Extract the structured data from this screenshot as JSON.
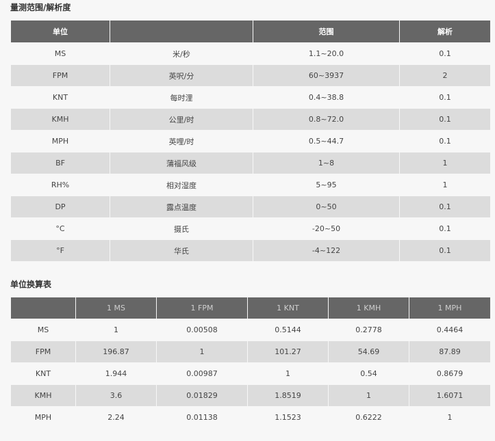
{
  "range_section": {
    "title": "量测范围/解析度",
    "headers": [
      "单位",
      "",
      "范围",
      "解析"
    ],
    "rows": [
      [
        "MS",
        "米/秒",
        "1.1~20.0",
        "0.1"
      ],
      [
        "FPM",
        "英呎/分",
        "60~3937",
        "2"
      ],
      [
        "KNT",
        "每时浬",
        "0.4~38.8",
        "0.1"
      ],
      [
        "KMH",
        "公里/时",
        "0.8~72.0",
        "0.1"
      ],
      [
        "MPH",
        "英哩/时",
        "0.5~44.7",
        "0.1"
      ],
      [
        "BF",
        "蒲福风级",
        "1~8",
        "1"
      ],
      [
        "RH%",
        "相对湿度",
        "5~95",
        "1"
      ],
      [
        "DP",
        "露点温度",
        "0~50",
        "0.1"
      ],
      [
        "°C",
        "摄氏",
        "-20~50",
        "0.1"
      ],
      [
        "°F",
        "华氏",
        "-4~122",
        "0.1"
      ]
    ]
  },
  "conversion_section": {
    "title": "单位换算表",
    "headers": [
      "",
      "1 MS",
      "1 FPM",
      "1 KNT",
      "1 KMH",
      "1 MPH"
    ],
    "rows": [
      [
        "MS",
        "1",
        "0.00508",
        "0.5144",
        "0.2778",
        "0.4464"
      ],
      [
        "FPM",
        "196.87",
        "1",
        "101.27",
        "54.69",
        "87.89"
      ],
      [
        "KNT",
        "1.944",
        "0.00987",
        "1",
        "0.54",
        "0.8679"
      ],
      [
        "KMH",
        "3.6",
        "0.01829",
        "1.8519",
        "1",
        "1.6071"
      ],
      [
        "MPH",
        "2.24",
        "0.01138",
        "1.1523",
        "0.6222",
        "1"
      ]
    ]
  }
}
